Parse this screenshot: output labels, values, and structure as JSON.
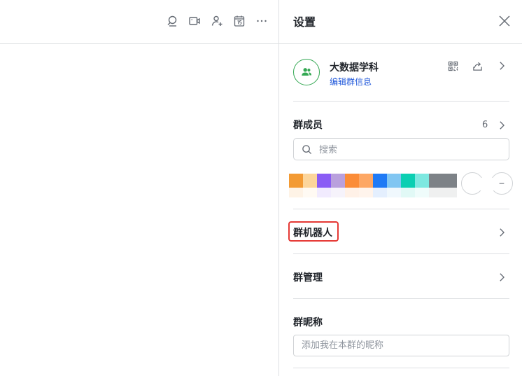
{
  "panel": {
    "title": "设置"
  },
  "group": {
    "name": "大数据学科",
    "edit_link": "编辑群信息"
  },
  "members": {
    "label": "群成员",
    "count": "6",
    "search_placeholder": "搜索",
    "avatar_colors": [
      "#f39a33",
      "#fcd59b",
      "#8a5cf5",
      "#b9a0dd",
      "#fb8c37",
      "#fda764",
      "#1f7af5",
      "#81c6f2",
      "#0bcfb2",
      "#7de8e0",
      "#7d8287",
      "#7d8287"
    ]
  },
  "bots": {
    "label": "群机器人"
  },
  "management": {
    "label": "群管理"
  },
  "nickname": {
    "label": "群昵称",
    "placeholder": "添加我在本群的昵称"
  },
  "colors": {
    "accent_green": "#34a853",
    "link_blue": "#245bdb",
    "highlight_red": "#e53935"
  },
  "icons": {
    "toolbar": [
      "search-icon",
      "video-call-icon",
      "add-member-icon",
      "calendar-icon",
      "more-icon"
    ],
    "header": [
      "qr-code-icon",
      "share-icon",
      "chevron-right-icon"
    ]
  }
}
